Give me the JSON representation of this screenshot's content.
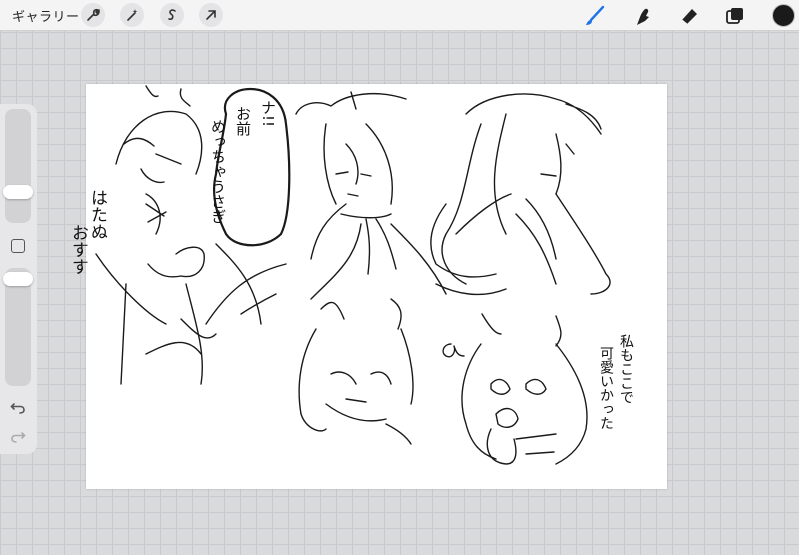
{
  "topbar": {
    "gallery_label": "ギャラリー"
  },
  "icons": {
    "actions": "wrench-icon",
    "adjustments": "magic-wand-icon",
    "selection": "selection-s-icon",
    "transform": "arrow-cursor-icon",
    "brush": "brush-icon",
    "smudge": "smudge-finger-icon",
    "eraser": "eraser-icon",
    "layers": "layers-icon"
  },
  "colors": {
    "active_tool": "#1e74e8",
    "current_color": "#1a1a1a"
  },
  "artwork": {
    "bubble_line1": "ナ!!",
    "bubble_line2": "お前",
    "bubble_line3": "めっちゃうさぎ",
    "left_text_1": "はたぬ",
    "left_text_2": "おすす",
    "right_text_1": "私もここで",
    "right_text_2": "可愛いかった",
    "doodle": "a"
  }
}
